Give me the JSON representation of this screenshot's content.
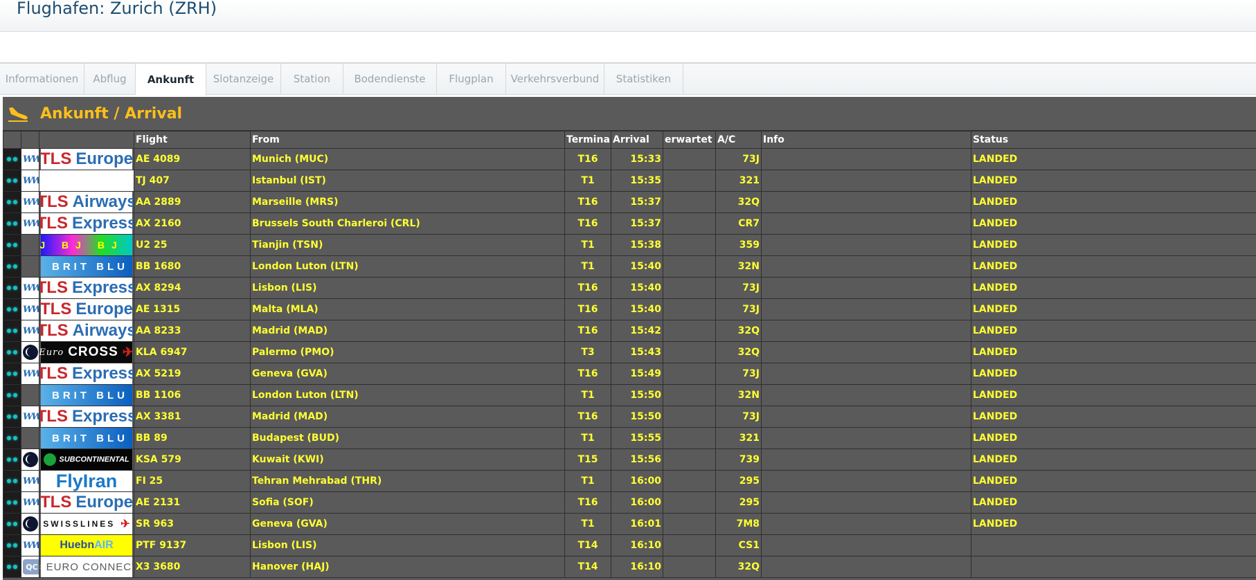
{
  "page": {
    "title": "Flughafen: Zurich (ZRH)"
  },
  "tabs": [
    {
      "label": "Informationen",
      "width": 122,
      "active": false
    },
    {
      "label": "Abflug",
      "width": 74,
      "active": false
    },
    {
      "label": "Ankunft",
      "width": 102,
      "active": true
    },
    {
      "label": "Slotanzeige",
      "width": 108,
      "active": false
    },
    {
      "label": "Station",
      "width": 90,
      "active": false
    },
    {
      "label": "Bodendienste",
      "width": 135,
      "active": false
    },
    {
      "label": "Flugplan",
      "width": 100,
      "active": false
    },
    {
      "label": "Verkehrsverbund",
      "width": 142,
      "active": false
    },
    {
      "label": "Statistiken",
      "width": 114,
      "active": false
    }
  ],
  "board": {
    "title": "Ankunft / Arrival",
    "icon": "plane-landing-icon",
    "columns": {
      "flight": "Flight",
      "from": "From",
      "terminal": "Terminal",
      "arrival": "Arrival",
      "expected": "erwartet",
      "ac": "A/C",
      "info": "Info",
      "status": "Status"
    },
    "rows": [
      {
        "alliance": "ww",
        "logo": "tls-europe",
        "flight": "AE 4089",
        "from": "Munich (MUC)",
        "terminal": "T16",
        "arrival": "15:33",
        "expected": "",
        "ac": "73J",
        "info": "",
        "status": "LANDED"
      },
      {
        "alliance": "ww",
        "logo": "none",
        "flight": "TJ 407",
        "from": "Istanbul (IST)",
        "terminal": "T1",
        "arrival": "15:35",
        "expected": "",
        "ac": "321",
        "info": "",
        "status": "LANDED"
      },
      {
        "alliance": "ww",
        "logo": "tls-airways",
        "flight": "AA 2889",
        "from": "Marseille (MRS)",
        "terminal": "T16",
        "arrival": "15:37",
        "expected": "",
        "ac": "32Q",
        "info": "",
        "status": "LANDED"
      },
      {
        "alliance": "ww",
        "logo": "tls-express",
        "flight": "AX 2160",
        "from": "Brussels South Charleroi (CRL)",
        "terminal": "T16",
        "arrival": "15:37",
        "expected": "",
        "ac": "CR7",
        "info": "",
        "status": "LANDED"
      },
      {
        "alliance": "none",
        "logo": "bj",
        "flight": "U2 25",
        "from": "Tianjin (TSN)",
        "terminal": "T1",
        "arrival": "15:38",
        "expected": "",
        "ac": "359",
        "info": "",
        "status": "LANDED"
      },
      {
        "alliance": "none",
        "logo": "brit-blu",
        "flight": "BB 1680",
        "from": "London Luton (LTN)",
        "terminal": "T1",
        "arrival": "15:40",
        "expected": "",
        "ac": "32N",
        "info": "",
        "status": "LANDED"
      },
      {
        "alliance": "ww",
        "logo": "tls-express",
        "flight": "AX 8294",
        "from": "Lisbon (LIS)",
        "terminal": "T16",
        "arrival": "15:40",
        "expected": "",
        "ac": "73J",
        "info": "",
        "status": "LANDED"
      },
      {
        "alliance": "ww",
        "logo": "tls-europe",
        "flight": "AE 1315",
        "from": "Malta (MLA)",
        "terminal": "T16",
        "arrival": "15:40",
        "expected": "",
        "ac": "73J",
        "info": "",
        "status": "LANDED"
      },
      {
        "alliance": "ww",
        "logo": "tls-airways",
        "flight": "AA 8233",
        "from": "Madrid (MAD)",
        "terminal": "T16",
        "arrival": "15:42",
        "expected": "",
        "ac": "32Q",
        "info": "",
        "status": "LANDED"
      },
      {
        "alliance": "circle",
        "logo": "euro-cross",
        "flight": "KLA 6947",
        "from": "Palermo (PMO)",
        "terminal": "T3",
        "arrival": "15:43",
        "expected": "",
        "ac": "32Q",
        "info": "",
        "status": "LANDED"
      },
      {
        "alliance": "ww",
        "logo": "tls-express",
        "flight": "AX 5219",
        "from": "Geneva (GVA)",
        "terminal": "T16",
        "arrival": "15:49",
        "expected": "",
        "ac": "73J",
        "info": "",
        "status": "LANDED"
      },
      {
        "alliance": "none",
        "logo": "brit-blu",
        "flight": "BB 1106",
        "from": "London Luton (LTN)",
        "terminal": "T1",
        "arrival": "15:50",
        "expected": "",
        "ac": "32N",
        "info": "",
        "status": "LANDED"
      },
      {
        "alliance": "ww",
        "logo": "tls-express",
        "flight": "AX 3381",
        "from": "Madrid (MAD)",
        "terminal": "T16",
        "arrival": "15:50",
        "expected": "",
        "ac": "73J",
        "info": "",
        "status": "LANDED"
      },
      {
        "alliance": "none",
        "logo": "brit-blu",
        "flight": "BB 89",
        "from": "Budapest (BUD)",
        "terminal": "T1",
        "arrival": "15:55",
        "expected": "",
        "ac": "321",
        "info": "",
        "status": "LANDED"
      },
      {
        "alliance": "circle",
        "logo": "subcontinental",
        "flight": "KSA 579",
        "from": "Kuwait (KWI)",
        "terminal": "T15",
        "arrival": "15:56",
        "expected": "",
        "ac": "739",
        "info": "",
        "status": "LANDED"
      },
      {
        "alliance": "ww",
        "logo": "flyiran",
        "flight": "FI 25",
        "from": "Tehran Mehrabad (THR)",
        "terminal": "T1",
        "arrival": "16:00",
        "expected": "",
        "ac": "295",
        "info": "",
        "status": "LANDED"
      },
      {
        "alliance": "ww",
        "logo": "tls-europe",
        "flight": "AE 2131",
        "from": "Sofia (SOF)",
        "terminal": "T16",
        "arrival": "16:00",
        "expected": "",
        "ac": "295",
        "info": "",
        "status": "LANDED"
      },
      {
        "alliance": "circle",
        "logo": "swisslines",
        "flight": "SR 963",
        "from": "Geneva (GVA)",
        "terminal": "T1",
        "arrival": "16:01",
        "expected": "",
        "ac": "7M8",
        "info": "",
        "status": "LANDED"
      },
      {
        "alliance": "ww",
        "logo": "huebnair",
        "flight": "PTF 9137",
        "from": "Lisbon (LIS)",
        "terminal": "T14",
        "arrival": "16:10",
        "expected": "",
        "ac": "CS1",
        "info": "",
        "status": ""
      },
      {
        "alliance": "qc",
        "logo": "euro-connect",
        "flight": "X3 3680",
        "from": "Hanover (HAJ)",
        "terminal": "T14",
        "arrival": "16:10",
        "expected": "",
        "ac": "32Q",
        "info": "",
        "status": ""
      }
    ]
  },
  "logos": {
    "tls-europe": {
      "a": "TLS",
      "b": "Europe"
    },
    "tls-airways": {
      "a": "TLS",
      "b": "Airways"
    },
    "tls-express": {
      "a": "TLS",
      "b": "Express"
    },
    "brit-blu": {
      "text": "BRIT BLU"
    },
    "bj": {
      "text": "BJ BJ BJ B"
    },
    "euro-cross": {
      "small": "Euro",
      "text": "CROSS"
    },
    "subcontinental": {
      "text": "SUBCONTINENTAL"
    },
    "flyiran": {
      "text": "FlyIran"
    },
    "swisslines": {
      "text": "SWISSLINES"
    },
    "huebnair": {
      "a": "Huebn",
      "b": "AIR"
    },
    "euro-connect": {
      "text": "EURO CONNECT"
    }
  },
  "alliance_marks": {
    "ww": "WW",
    "qc": "QC"
  },
  "colors": {
    "accent": "#ffbf1a",
    "row_text": "#ffff33",
    "board_bg": "#5a5a5a"
  }
}
